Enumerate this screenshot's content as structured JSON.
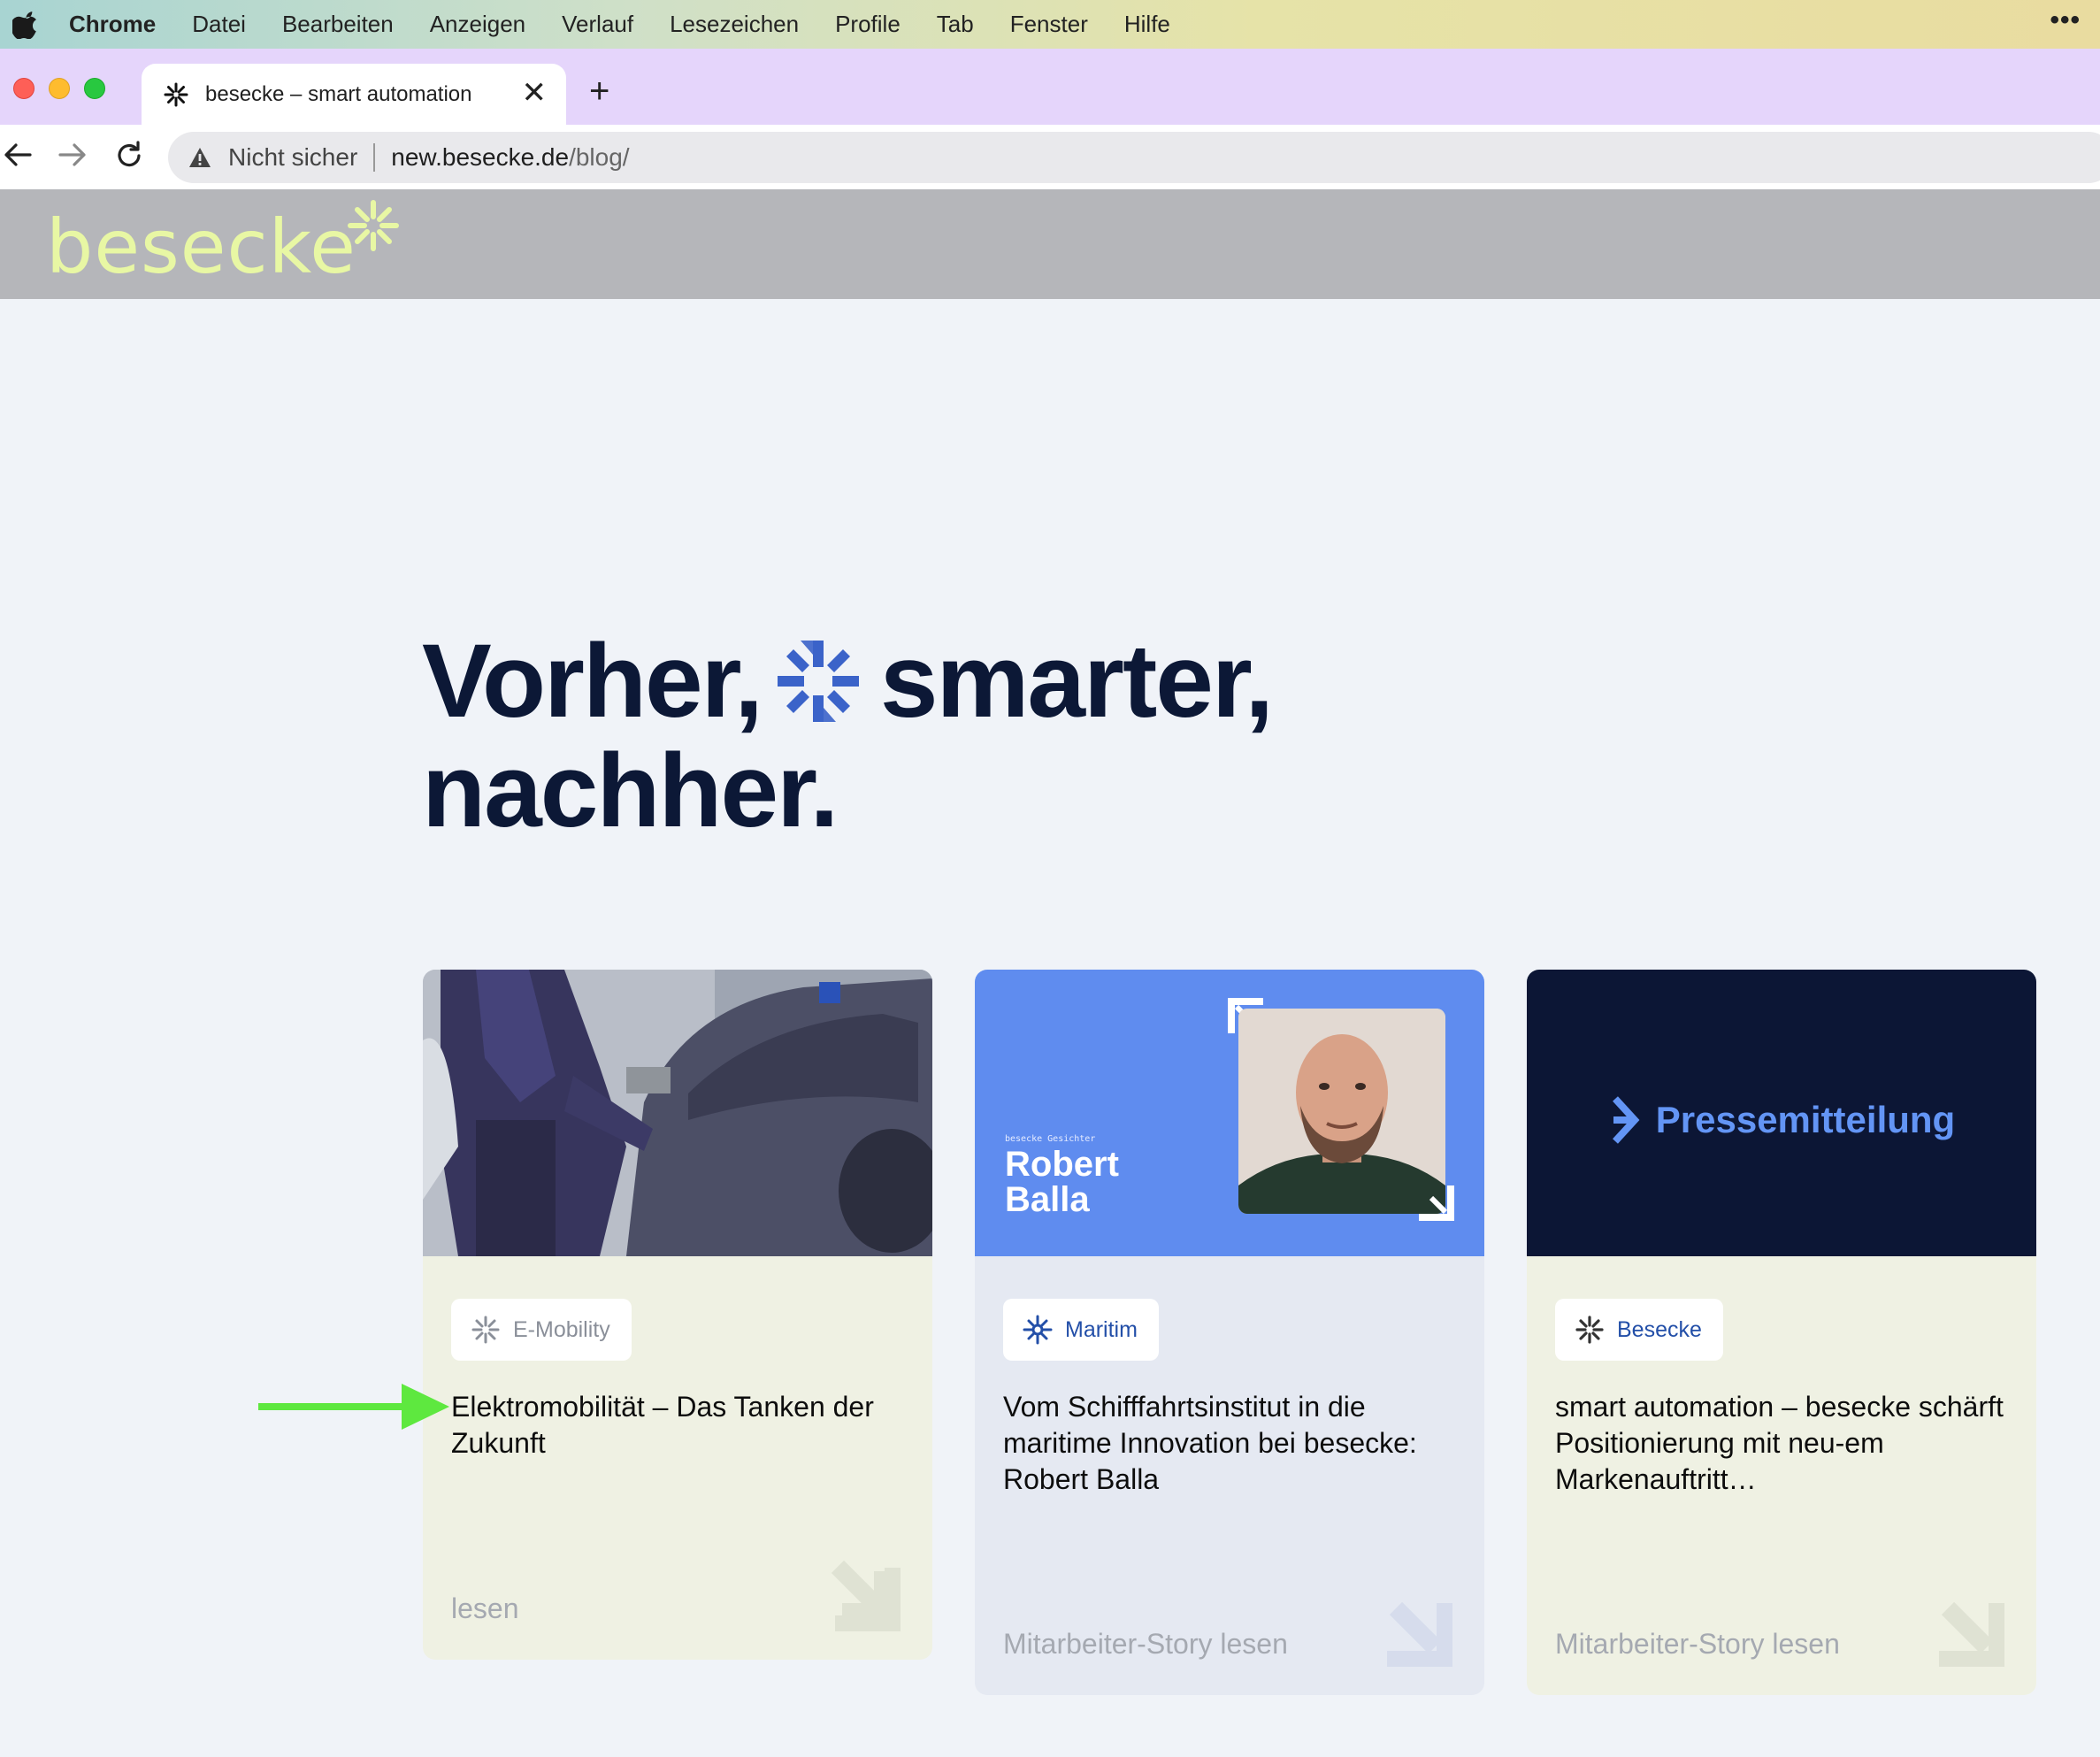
{
  "menubar": {
    "app": "Chrome",
    "items": [
      "Datei",
      "Bearbeiten",
      "Anzeigen",
      "Verlauf",
      "Lesezeichen",
      "Profile",
      "Tab",
      "Fenster",
      "Hilfe"
    ],
    "overflow": "•••"
  },
  "tab": {
    "title": "besecke – smart automation",
    "close": "✕",
    "new_tab": "+"
  },
  "omnibox": {
    "security": "Nicht sicher",
    "host": "new.besecke.de",
    "path": "/blog/"
  },
  "site": {
    "logo": "besecke",
    "logo_color": "#e8f7a4"
  },
  "hero": {
    "line1_a": "Vorher,",
    "line1_b": "smarter,",
    "line2": "nachher."
  },
  "cards": [
    {
      "tag": "E-Mobility",
      "tag_color": "#8a8f99",
      "title": "Elektromobilität – Das Tanken der Zukunft",
      "cta": "lesen"
    },
    {
      "tag": "Maritim",
      "tag_color": "#234fa8",
      "media_label": "besecke Gesichter",
      "media_name_1": "Robert",
      "media_name_2": "Balla",
      "title": "Vom Schifffahrtsinstitut in die maritime Innovation bei besecke: Robert Balla",
      "cta": "Mitarbeiter-Story lesen"
    },
    {
      "tag": "Besecke",
      "tag_color": "#234fa8",
      "media_label": "Pressemitteilung",
      "title": "smart automation – besecke schärft Positionierung mit neu-em Markenauftritt…",
      "cta": "Mitarbeiter-Story lesen"
    }
  ],
  "colors": {
    "accent_blue": "#3b63c9",
    "navy": "#0c1836",
    "annotation_green": "#5ee83f"
  }
}
